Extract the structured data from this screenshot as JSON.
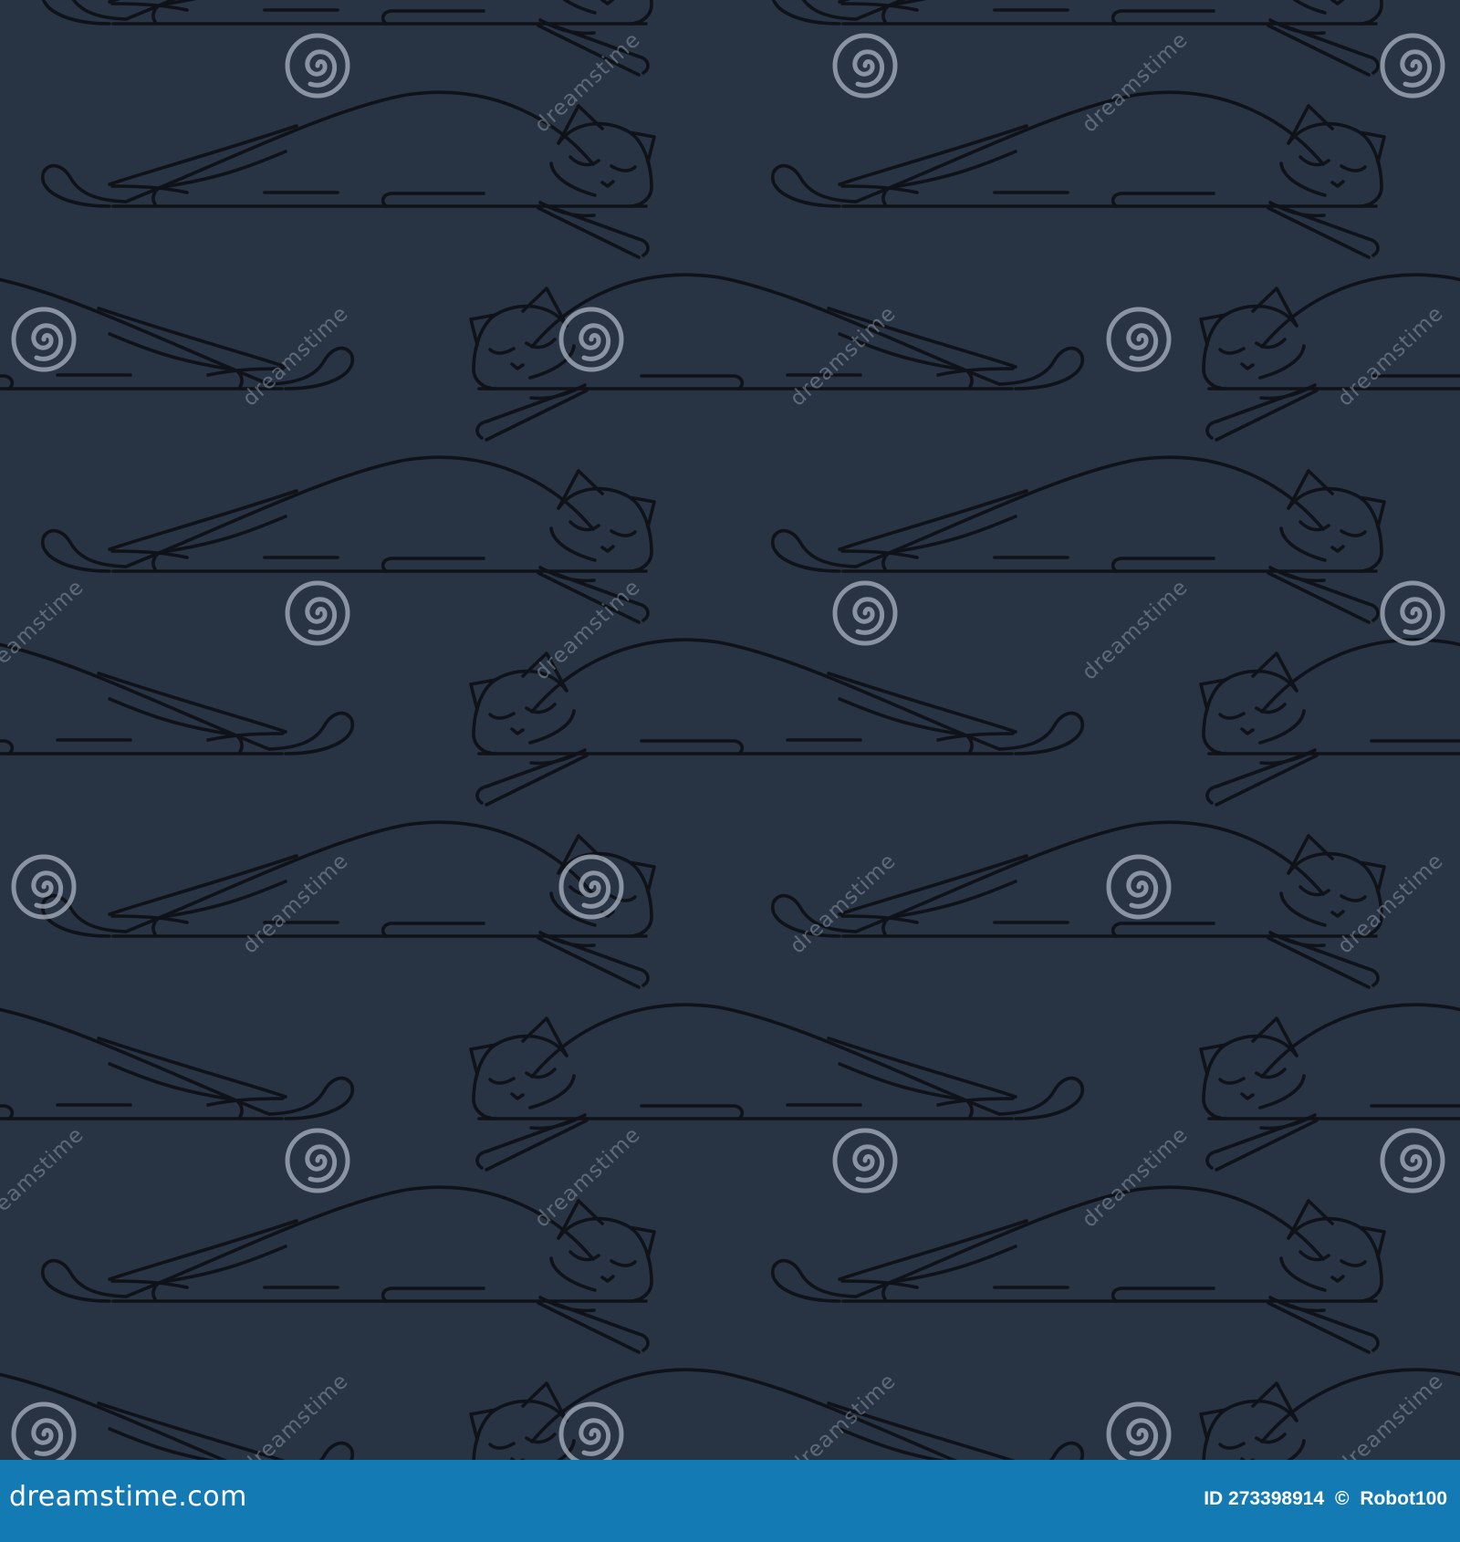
{
  "image": {
    "subject": "seamless-sleeping-cat-line-pattern",
    "background_color": "#283344",
    "outline_color": "#0f1218"
  },
  "watermark": {
    "text": "dreamstime",
    "icon": "dreamstime-spiral-icon"
  },
  "footer": {
    "brand": "dreamstime.com",
    "image_id": "ID 273398914",
    "separator": "©",
    "author": "Robot100",
    "background_color": "#137ab4"
  }
}
